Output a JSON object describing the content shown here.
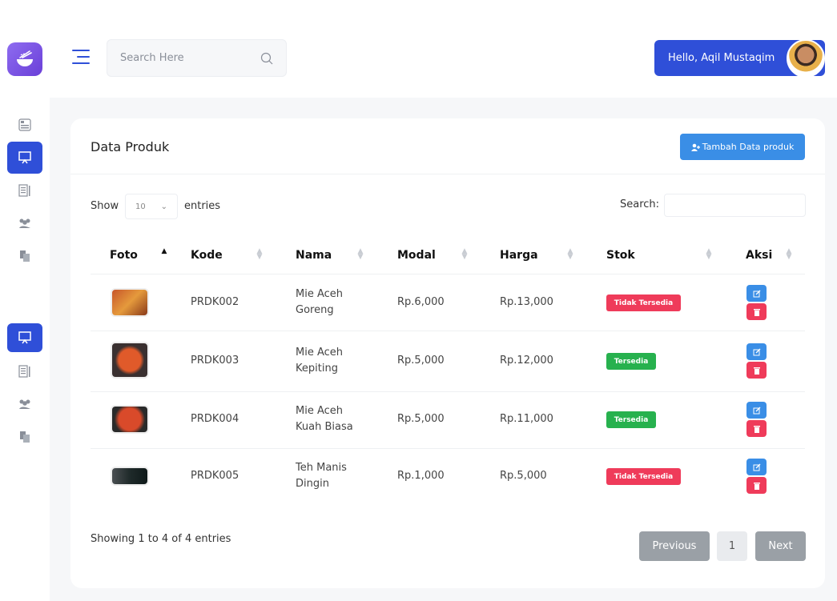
{
  "header": {
    "search_placeholder": "Search Here",
    "greeting": "Hello, Aqil Mustaqim"
  },
  "card": {
    "title": "Data Produk",
    "add_button_label": "Tambah Data produk"
  },
  "table_controls": {
    "show_label": "Show",
    "page_length": "10",
    "entries_label": "entries",
    "search_label": "Search:"
  },
  "table": {
    "columns": [
      "Foto",
      "Kode",
      "Nama",
      "Modal",
      "Harga",
      "Stok",
      "Aksi"
    ],
    "rows": [
      {
        "kode": "PRDK002",
        "nama_1": "Mie Aceh",
        "nama_2": "Goreng",
        "modal": "Rp.6,000",
        "harga": "Rp.13,000",
        "stok": "Tidak Tersedia"
      },
      {
        "kode": "PRDK003",
        "nama_1": "Mie Aceh",
        "nama_2": "Kepiting",
        "modal": "Rp.5,000",
        "harga": "Rp.12,000",
        "stok": "Tersedia"
      },
      {
        "kode": "PRDK004",
        "nama_1": "Mie Aceh",
        "nama_2": "Kuah Biasa",
        "modal": "Rp.5,000",
        "harga": "Rp.11,000",
        "stok": "Tersedia"
      },
      {
        "kode": "PRDK005",
        "nama_1": "Teh Manis",
        "nama_2": "Dingin",
        "modal": "Rp.1,000",
        "harga": "Rp.5,000",
        "stok": "Tidak Tersedia"
      }
    ]
  },
  "footer": {
    "info": "Showing 1 to 4 of 4 entries",
    "previous": "Previous",
    "page": "1",
    "next": "Next"
  },
  "colors": {
    "primary": "#2f4fd8",
    "button_blue": "#3a8ee6",
    "danger": "#ef3b5a",
    "success": "#27b14e"
  }
}
